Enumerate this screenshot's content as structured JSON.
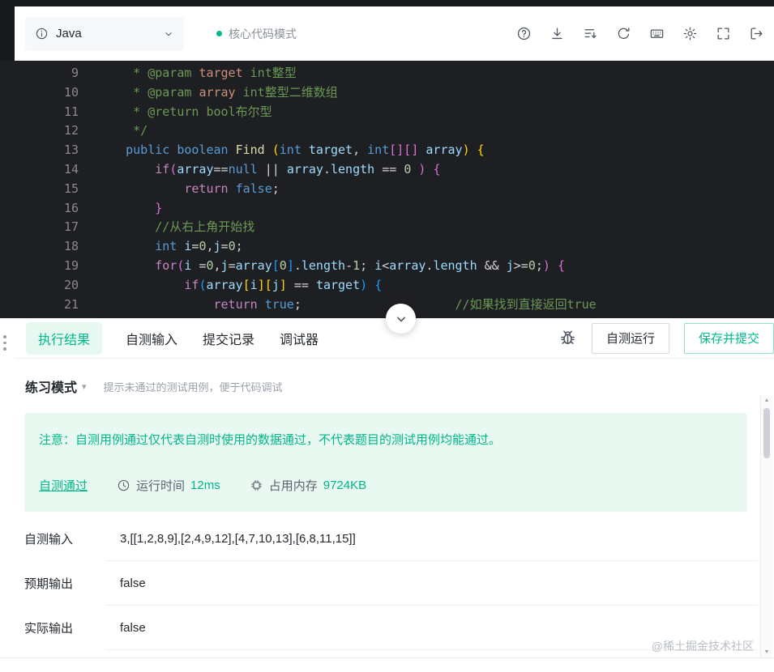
{
  "colors": {
    "accent": "#00b88a",
    "accent_bg": "#e9f8f1",
    "editor_bg": "#1e1f22"
  },
  "toolbar": {
    "language": "Java",
    "mode_label": "核心代码模式",
    "icons": [
      "language-info-icon",
      "chevron-down-icon",
      "help-icon",
      "download-icon",
      "run-config-icon",
      "refresh-icon",
      "keyboard-icon",
      "settings-gear-icon",
      "fullscreen-icon",
      "exit-window-icon"
    ]
  },
  "editor": {
    "lines": [
      {
        "num": "9",
        "tokens": [
          [
            "     * ",
            "cm"
          ],
          [
            "@param",
            "tag"
          ],
          [
            " ",
            "cm"
          ],
          [
            "target",
            "pn"
          ],
          [
            " int整型",
            "cm"
          ]
        ]
      },
      {
        "num": "10",
        "tokens": [
          [
            "     * ",
            "cm"
          ],
          [
            "@param",
            "tag"
          ],
          [
            " ",
            "cm"
          ],
          [
            "array",
            "pn"
          ],
          [
            " int整型二维数组",
            "cm"
          ]
        ]
      },
      {
        "num": "11",
        "tokens": [
          [
            "     * ",
            "cm"
          ],
          [
            "@return",
            "tag"
          ],
          [
            " bool布尔型",
            "cm"
          ]
        ]
      },
      {
        "num": "12",
        "tokens": [
          [
            "     */",
            "cm"
          ]
        ]
      },
      {
        "num": "13",
        "tokens": [
          [
            "    ",
            "df"
          ],
          [
            "public",
            "ty"
          ],
          [
            " ",
            "df"
          ],
          [
            "boolean",
            "ty"
          ],
          [
            " ",
            "df"
          ],
          [
            "Find",
            "fn"
          ],
          [
            " ",
            "df"
          ],
          [
            "(",
            "b1"
          ],
          [
            "int",
            "ty"
          ],
          [
            " ",
            "df"
          ],
          [
            "target",
            "vr"
          ],
          [
            ", ",
            "df"
          ],
          [
            "int",
            "ty"
          ],
          [
            "[][]",
            "b2"
          ],
          [
            " ",
            "df"
          ],
          [
            "array",
            "vr"
          ],
          [
            ")",
            "b1"
          ],
          [
            " ",
            "df"
          ],
          [
            "{",
            "b1"
          ]
        ]
      },
      {
        "num": "14",
        "tokens": [
          [
            "        ",
            "df"
          ],
          [
            "if",
            "kw"
          ],
          [
            "(",
            "b2"
          ],
          [
            "array",
            "vr"
          ],
          [
            "==",
            "df"
          ],
          [
            "null",
            "ty"
          ],
          [
            " || ",
            "df"
          ],
          [
            "array",
            "vr"
          ],
          [
            ".",
            "df"
          ],
          [
            "length",
            "vr"
          ],
          [
            " == ",
            "df"
          ],
          [
            "0",
            "nm"
          ],
          [
            " ",
            "df"
          ],
          [
            ")",
            "b2"
          ],
          [
            " ",
            "df"
          ],
          [
            "{",
            "b2"
          ]
        ]
      },
      {
        "num": "15",
        "tokens": [
          [
            "            ",
            "df"
          ],
          [
            "return",
            "kw"
          ],
          [
            " ",
            "df"
          ],
          [
            "false",
            "ty"
          ],
          [
            ";",
            "df"
          ]
        ]
      },
      {
        "num": "16",
        "tokens": [
          [
            "        ",
            "df"
          ],
          [
            "}",
            "b2"
          ]
        ]
      },
      {
        "num": "17",
        "tokens": [
          [
            "        ",
            "df"
          ],
          [
            "//从右上角开始找",
            "cm"
          ]
        ]
      },
      {
        "num": "18",
        "tokens": [
          [
            "        ",
            "df"
          ],
          [
            "int",
            "ty"
          ],
          [
            " ",
            "df"
          ],
          [
            "i",
            "vr"
          ],
          [
            "=",
            "df"
          ],
          [
            "0",
            "nm"
          ],
          [
            ",",
            "df"
          ],
          [
            "j",
            "vr"
          ],
          [
            "=",
            "df"
          ],
          [
            "0",
            "nm"
          ],
          [
            ";",
            "df"
          ]
        ]
      },
      {
        "num": "19",
        "tokens": [
          [
            "        ",
            "df"
          ],
          [
            "for",
            "kw"
          ],
          [
            "(",
            "b2"
          ],
          [
            "i",
            "vr"
          ],
          [
            " =",
            "df"
          ],
          [
            "0",
            "nm"
          ],
          [
            ",",
            "df"
          ],
          [
            "j",
            "vr"
          ],
          [
            "=",
            "df"
          ],
          [
            "array",
            "vr"
          ],
          [
            "[",
            "b3"
          ],
          [
            "0",
            "nm"
          ],
          [
            "]",
            "b3"
          ],
          [
            ".",
            "df"
          ],
          [
            "length",
            "vr"
          ],
          [
            "-",
            "df"
          ],
          [
            "1",
            "nm"
          ],
          [
            "; ",
            "df"
          ],
          [
            "i",
            "vr"
          ],
          [
            "<",
            "df"
          ],
          [
            "array",
            "vr"
          ],
          [
            ".",
            "df"
          ],
          [
            "length",
            "vr"
          ],
          [
            " && ",
            "df"
          ],
          [
            "j",
            "vr"
          ],
          [
            ">=",
            "df"
          ],
          [
            "0",
            "nm"
          ],
          [
            ";",
            "df"
          ],
          [
            ")",
            "b2"
          ],
          [
            " ",
            "df"
          ],
          [
            "{",
            "b2"
          ]
        ]
      },
      {
        "num": "20",
        "tokens": [
          [
            "            ",
            "df"
          ],
          [
            "if",
            "kw"
          ],
          [
            "(",
            "b3"
          ],
          [
            "array",
            "vr"
          ],
          [
            "[",
            "b1"
          ],
          [
            "i",
            "vr"
          ],
          [
            "]",
            "b1"
          ],
          [
            "[",
            "b1"
          ],
          [
            "j",
            "vr"
          ],
          [
            "]",
            "b1"
          ],
          [
            " == ",
            "df"
          ],
          [
            "target",
            "vr"
          ],
          [
            ")",
            "b3"
          ],
          [
            " ",
            "df"
          ],
          [
            "{",
            "b3"
          ]
        ]
      },
      {
        "num": "21",
        "tokens": [
          [
            "                ",
            "df"
          ],
          [
            "return",
            "kw"
          ],
          [
            " ",
            "df"
          ],
          [
            "true",
            "ty"
          ],
          [
            ";",
            "df"
          ],
          [
            "                     ",
            "df"
          ],
          [
            "//如果找到直接返回true",
            "cm"
          ]
        ]
      }
    ]
  },
  "tabs": [
    {
      "key": "result",
      "label": "执行结果",
      "active": true
    },
    {
      "key": "self-test-input",
      "label": "自测输入",
      "active": false
    },
    {
      "key": "submissions",
      "label": "提交记录",
      "active": false
    },
    {
      "key": "debugger",
      "label": "调试器",
      "active": false
    }
  ],
  "actions": {
    "self_test_run": "自测运行",
    "save_submit": "保存并提交"
  },
  "practice": {
    "mode_label": "练习模式",
    "hint": "提示未通过的测试用例，便于代码调试"
  },
  "result": {
    "notice": "注意：自测用例通过仅代表自测时使用的数据通过，不代表题目的测试用例均能通过。",
    "status": "自测通过",
    "runtime_label": "运行时间",
    "runtime_value": "12ms",
    "memory_label": "占用内存",
    "memory_value": "9724KB"
  },
  "io_rows": [
    {
      "label": "自测输入",
      "value": "3,[[1,2,8,9],[2,4,9,12],[4,7,10,13],[6,8,11,15]]"
    },
    {
      "label": "预期输出",
      "value": "false"
    },
    {
      "label": "实际输出",
      "value": "false"
    }
  ],
  "watermark": "@稀土掘金技术社区"
}
